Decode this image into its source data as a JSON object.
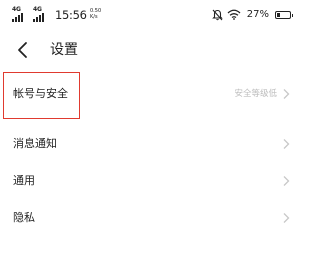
{
  "status_bar": {
    "signal_1_label": "4G",
    "signal_2_label": "4G",
    "time": "15:56",
    "net_speed": "0.50 K/s",
    "battery_percent": "27%",
    "battery_level": 0.27,
    "icons": [
      "signal-icon",
      "signal-icon",
      "mute-icon",
      "wifi-icon",
      "battery-icon"
    ]
  },
  "header": {
    "title": "设置"
  },
  "settings_list": [
    {
      "label": "帐号与安全",
      "value": "安全等级低"
    },
    {
      "label": "消息通知",
      "value": ""
    },
    {
      "label": "通用",
      "value": ""
    },
    {
      "label": "隐私",
      "value": ""
    }
  ],
  "colors": {
    "highlight_border": "#e03a2f",
    "secondary_text": "#bdbdbd",
    "chevron": "#c8c8c8"
  }
}
